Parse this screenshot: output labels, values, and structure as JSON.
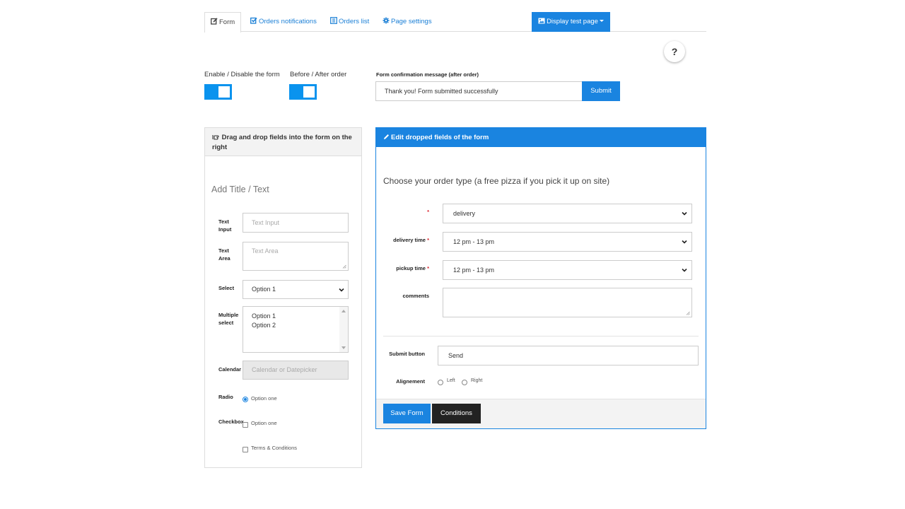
{
  "nav": {
    "tabs": [
      {
        "label": "Form",
        "icon": "edit-icon",
        "active": true
      },
      {
        "label": "Orders notifications",
        "icon": "check-square-icon",
        "active": false
      },
      {
        "label": "Orders list",
        "icon": "list-icon",
        "active": false
      },
      {
        "label": "Page settings",
        "icon": "gear-icon",
        "active": false
      }
    ],
    "display_button": {
      "label": "Display test page",
      "icon": "image-icon"
    }
  },
  "help": {
    "label": "?"
  },
  "toggles": [
    {
      "label": "Enable / Disable the form",
      "on": true
    },
    {
      "label": "Before / After order",
      "on": true
    }
  ],
  "confirmation": {
    "label": "Form confirmation message (after order)",
    "value": "Thank you! Form submitted successfully",
    "submit_label": "Submit"
  },
  "left_panel": {
    "title": "Drag and drop fields into the form on the right",
    "add_title": "Add Title / Text",
    "fields": {
      "text_input": {
        "label_1": "Text",
        "label_2": "Input",
        "placeholder": "Text Input"
      },
      "text_area": {
        "label_1": "Text",
        "label_2": "Area",
        "placeholder": "Text Area"
      },
      "select": {
        "label": "Select",
        "value": "Option 1"
      },
      "multiple_select": {
        "label_1": "Multiple",
        "label_2": "select",
        "options": [
          "Option 1",
          "Option 2"
        ]
      },
      "calendar": {
        "label": "Calendar",
        "placeholder": "Calendar or Datepicker"
      },
      "radio": {
        "label": "Radio",
        "option": "Option one",
        "checked": true
      },
      "checkbox": {
        "label": "Checkbox",
        "options": [
          "Option one",
          "Terms & Conditions"
        ]
      }
    }
  },
  "right_panel": {
    "title": "Edit dropped fields of the form",
    "form_title": "Choose your order type (a free pizza if you pick it up on site)",
    "fields": [
      {
        "label": "",
        "required": "*",
        "value": "delivery",
        "type": "select"
      },
      {
        "label": "delivery time",
        "required": "*",
        "value": "12 pm - 13 pm",
        "type": "select"
      },
      {
        "label": "pickup time",
        "required": "*",
        "value": "12 pm - 13 pm",
        "type": "select"
      },
      {
        "label": "comments",
        "required": "",
        "value": "",
        "type": "textarea"
      }
    ],
    "submit_button": {
      "label": "Submit button",
      "value": "Send"
    },
    "alignment": {
      "label": "Alignement",
      "options": [
        "Left",
        "Right"
      ]
    },
    "save_label": "Save Form",
    "conditions_label": "Conditions"
  },
  "colors": {
    "accent": "#1a84e0",
    "toggle": "#0a93ee",
    "dark_button": "#222222",
    "required": "#d9232d"
  }
}
